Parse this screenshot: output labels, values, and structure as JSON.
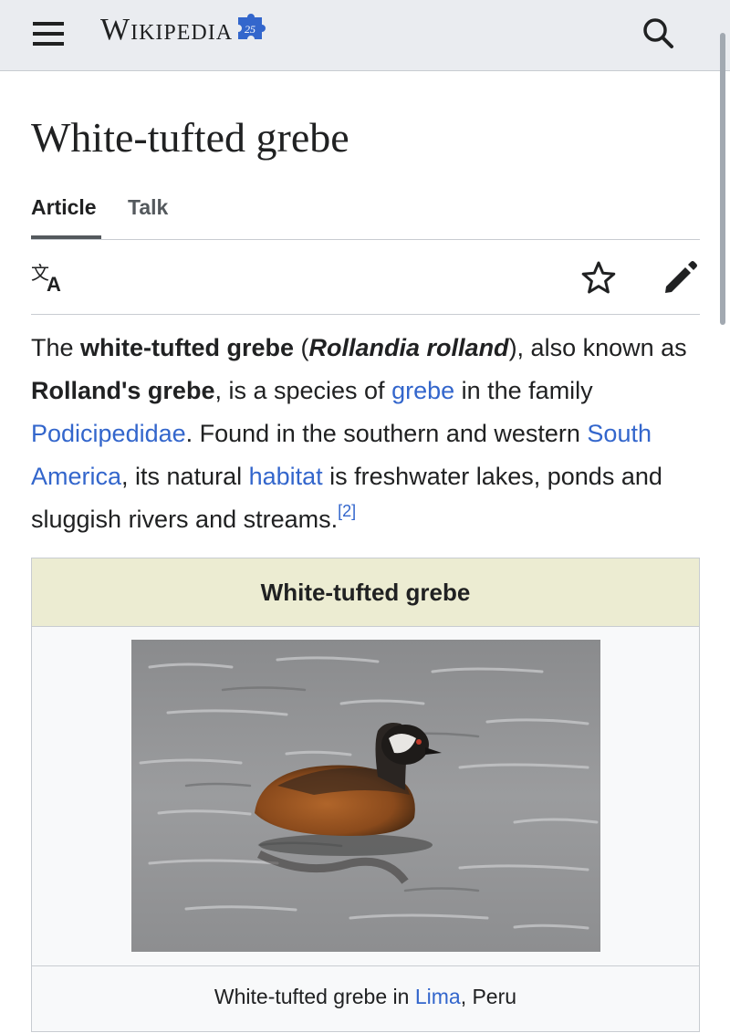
{
  "header": {
    "logo_text": "Wikipedia",
    "badge": "25",
    "menu_icon": "hamburger-menu-icon",
    "search_icon": "search-icon"
  },
  "article": {
    "title": "White-tufted grebe",
    "tabs": [
      {
        "label": "Article",
        "selected": true
      },
      {
        "label": "Talk",
        "selected": false
      }
    ],
    "actions": {
      "language_icon": "language-icon",
      "watch_icon": "star-icon",
      "edit_icon": "pencil-icon"
    },
    "lead": {
      "t1": "The ",
      "common_name": "white-tufted grebe",
      "t2": " (",
      "scientific_name": "Rollandia rolland",
      "t3": "), also known as ",
      "alt_name": "Rolland's grebe",
      "t4": ", is a species of ",
      "link_grebe": "grebe",
      "t5": " in the family ",
      "link_family": "Podicipedidae",
      "t6": ". Found in the southern and western ",
      "link_region": "South America",
      "t7": ", its natural ",
      "link_habitat": "habitat",
      "t8": " is freshwater lakes, ponds and sluggish rivers and streams.",
      "citation": "[2]"
    },
    "infobox": {
      "title": "White-tufted grebe",
      "caption_before": "White-tufted grebe in ",
      "caption_link": "Lima",
      "caption_after": ", Peru"
    }
  },
  "colors": {
    "link": "#3366cc",
    "header_bg": "#eaecf0",
    "infobox_header_bg": "#ececd2"
  }
}
